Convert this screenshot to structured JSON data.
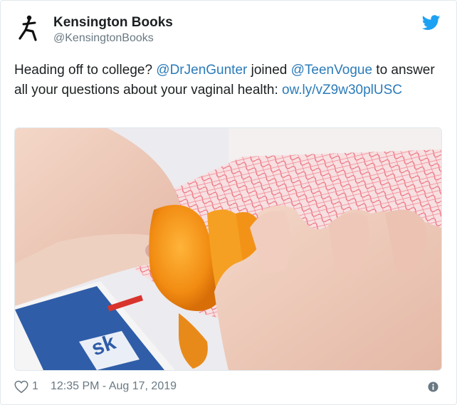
{
  "tweet": {
    "author_name": "Kensington Books",
    "author_handle": "@KensingtonBooks",
    "text_part1": "Heading off to college? ",
    "mention1": "@DrJenGunter",
    "text_part2": " joined ",
    "mention2": "@TeenVogue",
    "text_part3": " to answer all your questions about your vaginal health: ",
    "link": "ow.ly/vZ9w30plUSC",
    "likes": "1",
    "timestamp": "12:35 PM - Aug 17, 2019"
  },
  "colors": {
    "accent": "#2b7bb9",
    "twitter_blue": "#1da1f2",
    "secondary_text": "#697882"
  },
  "icons": [
    "kensington-logo-icon",
    "twitter-bird-icon",
    "heart-icon",
    "info-icon"
  ]
}
